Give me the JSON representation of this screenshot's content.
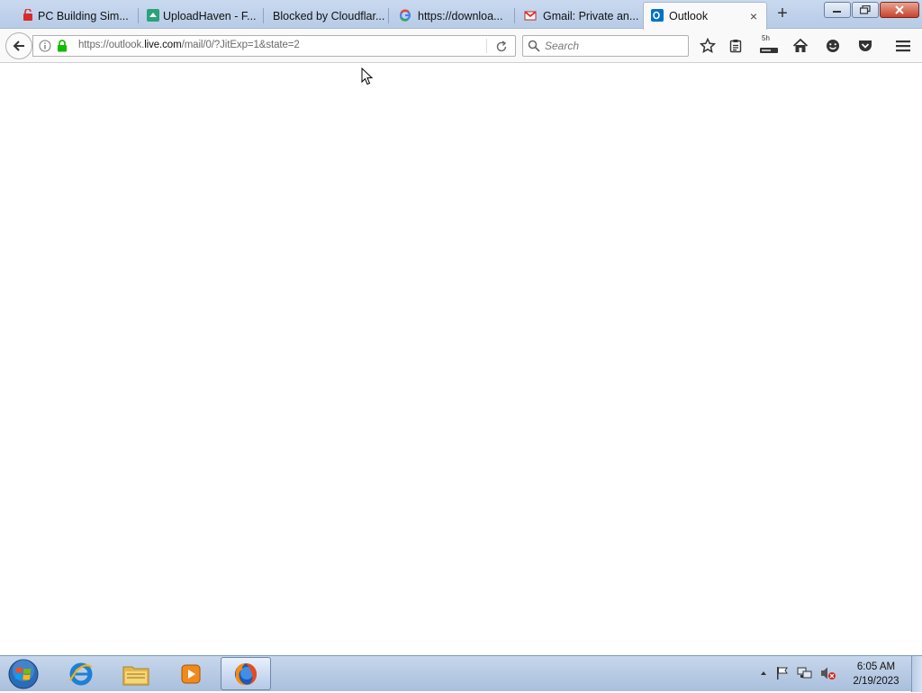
{
  "browser": {
    "tabs": [
      {
        "title": "PC Building Sim...",
        "icon": "steam-sale-icon"
      },
      {
        "title": "UploadHaven - F...",
        "icon": "uploadhaven-icon"
      },
      {
        "title": "Blocked by Cloudflar...",
        "icon": ""
      },
      {
        "title": "https://downloa...",
        "icon": "google-icon"
      },
      {
        "title": "Gmail: Private an...",
        "icon": "gmail-icon"
      },
      {
        "title": "Outlook",
        "icon": "outlook-icon",
        "active": true
      }
    ],
    "tab_close": "×",
    "new_tab": "+",
    "url_prefix": "https://outlook.",
    "url_domain": "live.com",
    "url_path": "/mail/0/?JitExp=1&state=2",
    "search_placeholder": "Search",
    "download_badge": "5h"
  },
  "taskbar": {
    "time": "6:05 AM",
    "date": "2/19/2023",
    "apps": [
      "internet-explorer-icon",
      "file-explorer-icon",
      "media-player-icon",
      "firefox-icon"
    ]
  },
  "colors": {
    "accent": "#0a84ff",
    "outlook_blue": "#0072c6",
    "lock_green": "#12bc00",
    "taskbar": "#b4c8e3"
  }
}
